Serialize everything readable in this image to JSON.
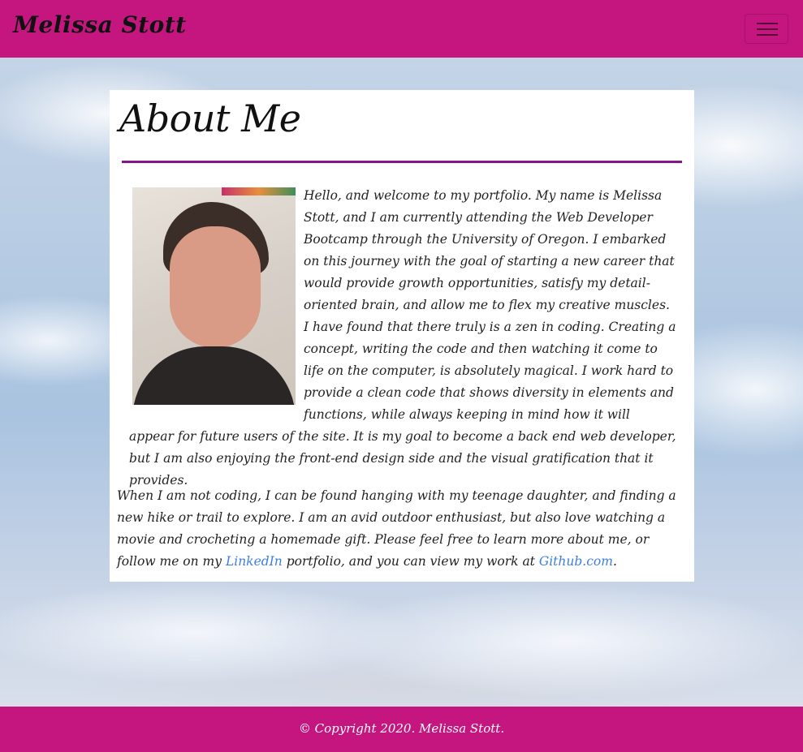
{
  "navbar": {
    "brand": "Melissa Stott",
    "toggler_icon": "hamburger-icon",
    "background_color": "#c5167f"
  },
  "about": {
    "heading": "About Me",
    "divider_color": "#85158a",
    "photo_alt": "Melissa Stott",
    "bio": "Hello, and welcome to my portfolio. My name is Melissa Stott, and I am currently attending the Web Developer Bootcamp through the University of Oregon. I embarked on this journey with the goal of starting a new career that would provide growth opportunities, satisfy my detail-oriented brain, and allow me to flex my creative muscles. I have found that there truly is a zen in coding. Creating a concept, writing the code and then watching it come to life on the computer, is absolutely magical. I work hard to provide a clean code that shows diversity in elements and functions, while always keeping in mind how it will appear for future users of the site. It is my goal to become a back end web developer, but I am also enjoying the front-end design side and the visual gratification that it provides.",
    "outro_part1": "When I am not coding, I can be found hanging with my teenage daughter, and finding a new hike or trail to explore. I am an avid outdoor enthusiast, but also love watching a movie and crocheting a homemade gift. Please feel free to learn more about me, or follow me on my ",
    "linkedin_label": "LinkedIn",
    "outro_part2": " portfolio, and you can view my work at ",
    "github_label": "Github.com",
    "outro_end": ".",
    "link_color": "#3d7fe0"
  },
  "footer": {
    "copyright": "© Copyright 2020. Melissa Stott.",
    "background_color": "#c5167f"
  }
}
